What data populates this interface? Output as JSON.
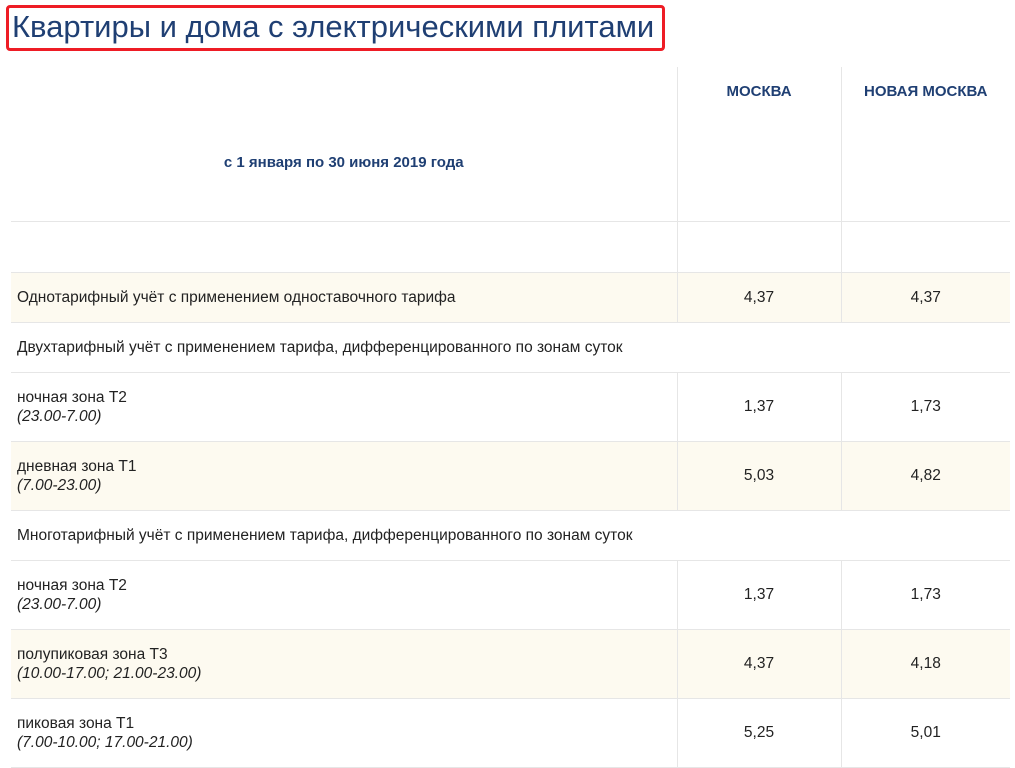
{
  "title": "Квартиры и дома с электрическими плитами",
  "table": {
    "period": "с 1 января по 30 июня 2019 года",
    "columns": [
      "МОСКВА",
      "НОВАЯ МОСКВА"
    ],
    "rows": [
      {
        "label": "Однотарифный учёт с применением одноставочного тарифа",
        "moscow": "4,37",
        "new_moscow": "4,37"
      },
      {
        "group": "Двухтарифный учёт с применением тарифа, дифференцированного по зонам суток"
      },
      {
        "label": "ночная зона Т2",
        "hours": "(23.00-7.00)",
        "moscow": "1,37",
        "new_moscow": "1,73"
      },
      {
        "label": "дневная зона Т1",
        "hours": "(7.00-23.00)",
        "moscow": "5,03",
        "new_moscow": "4,82"
      },
      {
        "group": "Многотарифный учёт с применением тарифа, дифференцированного по зонам суток"
      },
      {
        "label": "ночная зона Т2",
        "hours": "(23.00-7.00)",
        "moscow": "1,37",
        "new_moscow": "1,73"
      },
      {
        "label": "полупиковая зона Т3",
        "hours": "(10.00-17.00; 21.00-23.00)",
        "moscow": "4,37",
        "new_moscow": "4,18"
      },
      {
        "label": "пиковая зона Т1",
        "hours": "(7.00-10.00; 17.00-21.00)",
        "moscow": "5,25",
        "new_moscow": "5,01"
      }
    ]
  },
  "colors": {
    "title": "#1f3f73",
    "highlight_border": "#ee1c25",
    "row_shade": "#fdfaf0"
  }
}
